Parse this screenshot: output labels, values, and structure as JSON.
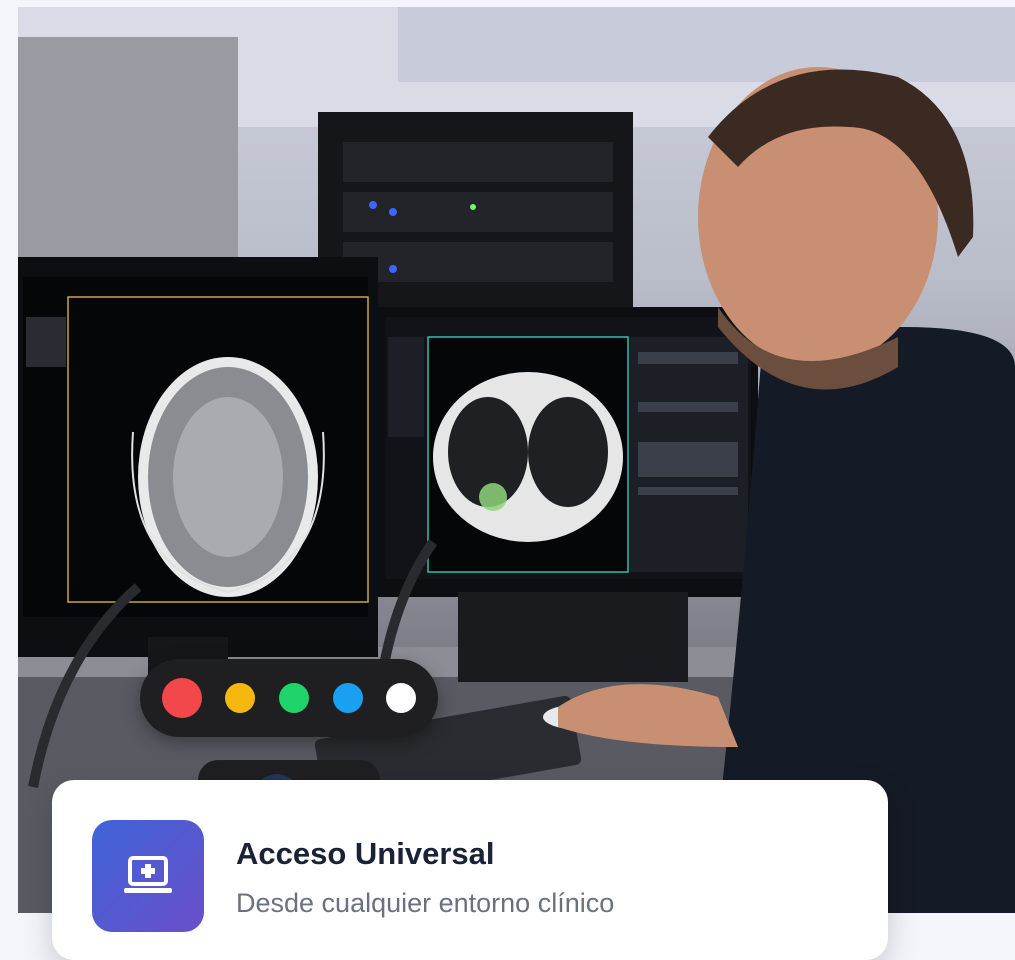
{
  "palette": {
    "label": "Selector de color",
    "colors": [
      "#f2484b",
      "#f6b80f",
      "#1fd36b",
      "#1aa0f0",
      "#ffffff"
    ]
  },
  "feature": {
    "title": "Acceso Universal",
    "subtitle": "Desde cualquier entorno clínico",
    "icon": "laptop-medical-icon",
    "icon_gradient": [
      "#3f64d8",
      "#6a4fc9"
    ]
  }
}
